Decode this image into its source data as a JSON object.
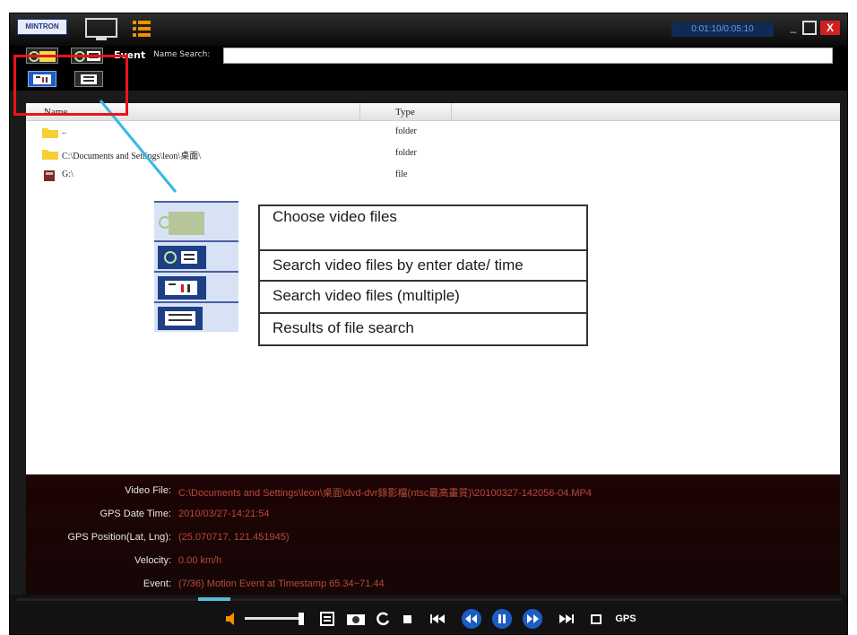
{
  "titlebar": {
    "logo_text": "MINTRON",
    "time_display": "0:01:10/0:05:10",
    "minimize_glyph": "_",
    "close_glyph": "X"
  },
  "toolbar": {
    "event_label": "Event",
    "name_search_label": "Name Search:",
    "name_search_value": ""
  },
  "filelist": {
    "columns": {
      "name": "Name",
      "type": "Type"
    },
    "rows": [
      {
        "name": "..",
        "type": "folder",
        "icon": "folder-icon"
      },
      {
        "name": "C:\\Documents and Settings\\leon\\桌面\\",
        "type": "folder",
        "icon": "folder-icon"
      },
      {
        "name": "G:\\",
        "type": "file",
        "icon": "drive-icon"
      }
    ]
  },
  "callout": {
    "items": [
      {
        "text": "Choose video files",
        "icon": "folder-open-icon"
      },
      {
        "text": "Search video files by enter date/ time",
        "icon": "search-list-icon"
      },
      {
        "text": "Search video files (multiple)",
        "icon": "multi-search-icon"
      },
      {
        "text": "Results of file search",
        "icon": "results-list-icon"
      }
    ]
  },
  "info": {
    "video_file_label": "Video File:",
    "video_file_value": "C:\\Documents and Settings\\leon\\桌面\\dvd-dvr錄影檔(ntsc最高畫質)\\20100327-142056-04.MP4",
    "gps_date_label": "GPS Date Time:",
    "gps_date_value": "2010/03/27-14:21:54",
    "gps_pos_label": "GPS Position(Lat, Lng):",
    "gps_pos_value": "(25.070717, 121.451945)",
    "velocity_label": "Velocity:",
    "velocity_value": "0.00 km/h",
    "event_label": "Event:",
    "event_value": "(7/36) Motion Event at Timestamp 65.34~71.44"
  },
  "controls": {
    "gps_label": "GPS",
    "volume_level": 0.9
  },
  "colors": {
    "highlight_box": "#e8141a",
    "leader_line": "#38b8e0",
    "info_value": "#b84a3a",
    "accent_blue": "#1c5cc4"
  }
}
